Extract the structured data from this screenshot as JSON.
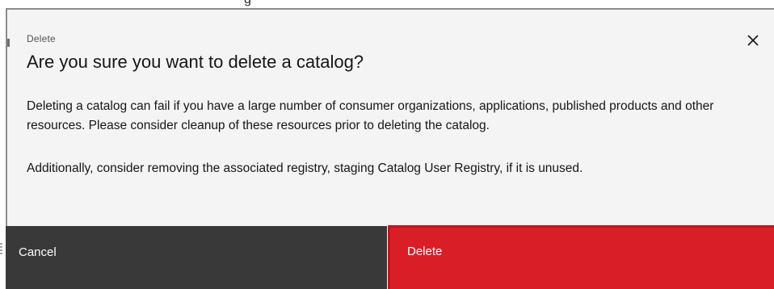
{
  "backdrop": {
    "fragment": "g"
  },
  "modal": {
    "label": "Delete",
    "heading": "Are you sure you want to delete a catalog?",
    "close_icon": "close-icon",
    "paragraphs": [
      "Deleting a catalog can fail if you have a large number of consumer organizations, applications, published products and other resources. Please consider cleanup of these resources prior to deleting the catalog.",
      "Additionally, consider removing the associated registry, staging Catalog User Registry, if it is unused."
    ],
    "footer": {
      "cancel_label": "Cancel",
      "delete_label": "Delete"
    }
  },
  "colors": {
    "modal_bg": "#f4f4f4",
    "cancel_bg": "#393939",
    "danger_bg": "#da1e28",
    "text": "#161616"
  }
}
